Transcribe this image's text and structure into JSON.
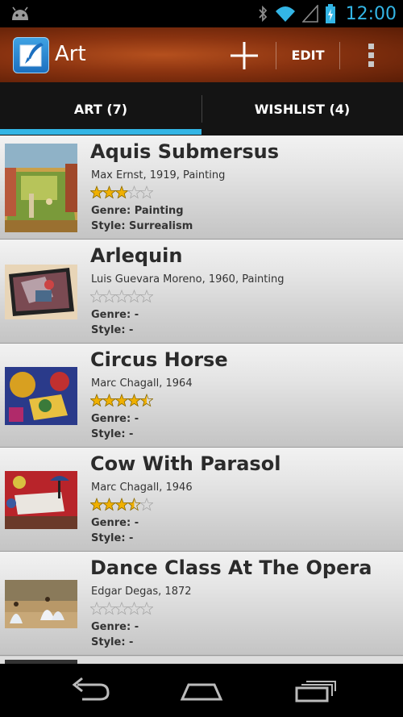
{
  "status_bar": {
    "time": "12:00",
    "icons": [
      "android-debug-icon",
      "bluetooth-icon",
      "wifi-icon",
      "signal-icon",
      "battery-icon"
    ],
    "accent_color": "#33b5e5"
  },
  "action_bar": {
    "title": "Art",
    "edit_label": "EDIT",
    "icons": [
      "app-logo-icon",
      "add-icon",
      "overflow-menu-icon"
    ]
  },
  "tabs": [
    {
      "label": "ART (7)",
      "selected": true
    },
    {
      "label": "WISHLIST (4)",
      "selected": false
    }
  ],
  "items": [
    {
      "title": "Aquis Submersus",
      "meta": "Max Ernst, 1919, Painting",
      "rating": 3,
      "max_rating": 5,
      "genre": "Genre: Painting",
      "style": "Style: Surrealism"
    },
    {
      "title": "Arlequin",
      "meta": "Luis Guevara Moreno, 1960, Painting",
      "rating": 0,
      "max_rating": 5,
      "genre": "Genre: -",
      "style": "Style: -"
    },
    {
      "title": "Circus Horse",
      "meta": "Marc Chagall, 1964",
      "rating": 4.5,
      "max_rating": 5,
      "genre": "Genre: -",
      "style": "Style: -"
    },
    {
      "title": "Cow With Parasol",
      "meta": "Marc Chagall, 1946",
      "rating": 3.5,
      "max_rating": 5,
      "genre": "Genre: -",
      "style": "Style: -"
    },
    {
      "title": "Dance Class At The Opera",
      "meta": "Edgar Degas, 1872",
      "rating": 0,
      "max_rating": 5,
      "genre": "Genre: -",
      "style": "Style: -"
    }
  ],
  "nav_bar": {
    "icons": [
      "back-icon",
      "home-icon",
      "recent-apps-icon"
    ]
  }
}
